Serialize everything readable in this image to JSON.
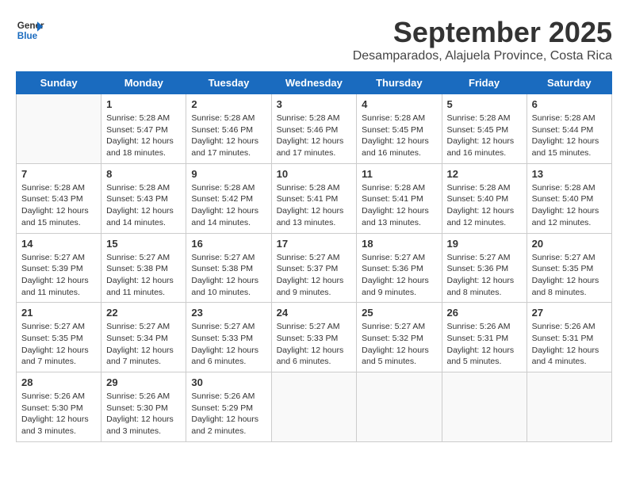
{
  "logo": {
    "line1": "General",
    "line2": "Blue"
  },
  "title": "September 2025",
  "location": "Desamparados, Alajuela Province, Costa Rica",
  "headers": [
    "Sunday",
    "Monday",
    "Tuesday",
    "Wednesday",
    "Thursday",
    "Friday",
    "Saturday"
  ],
  "weeks": [
    [
      {
        "day": "",
        "info": ""
      },
      {
        "day": "1",
        "info": "Sunrise: 5:28 AM\nSunset: 5:47 PM\nDaylight: 12 hours\nand 18 minutes."
      },
      {
        "day": "2",
        "info": "Sunrise: 5:28 AM\nSunset: 5:46 PM\nDaylight: 12 hours\nand 17 minutes."
      },
      {
        "day": "3",
        "info": "Sunrise: 5:28 AM\nSunset: 5:46 PM\nDaylight: 12 hours\nand 17 minutes."
      },
      {
        "day": "4",
        "info": "Sunrise: 5:28 AM\nSunset: 5:45 PM\nDaylight: 12 hours\nand 16 minutes."
      },
      {
        "day": "5",
        "info": "Sunrise: 5:28 AM\nSunset: 5:45 PM\nDaylight: 12 hours\nand 16 minutes."
      },
      {
        "day": "6",
        "info": "Sunrise: 5:28 AM\nSunset: 5:44 PM\nDaylight: 12 hours\nand 15 minutes."
      }
    ],
    [
      {
        "day": "7",
        "info": "Sunrise: 5:28 AM\nSunset: 5:43 PM\nDaylight: 12 hours\nand 15 minutes."
      },
      {
        "day": "8",
        "info": "Sunrise: 5:28 AM\nSunset: 5:43 PM\nDaylight: 12 hours\nand 14 minutes."
      },
      {
        "day": "9",
        "info": "Sunrise: 5:28 AM\nSunset: 5:42 PM\nDaylight: 12 hours\nand 14 minutes."
      },
      {
        "day": "10",
        "info": "Sunrise: 5:28 AM\nSunset: 5:41 PM\nDaylight: 12 hours\nand 13 minutes."
      },
      {
        "day": "11",
        "info": "Sunrise: 5:28 AM\nSunset: 5:41 PM\nDaylight: 12 hours\nand 13 minutes."
      },
      {
        "day": "12",
        "info": "Sunrise: 5:28 AM\nSunset: 5:40 PM\nDaylight: 12 hours\nand 12 minutes."
      },
      {
        "day": "13",
        "info": "Sunrise: 5:28 AM\nSunset: 5:40 PM\nDaylight: 12 hours\nand 12 minutes."
      }
    ],
    [
      {
        "day": "14",
        "info": "Sunrise: 5:27 AM\nSunset: 5:39 PM\nDaylight: 12 hours\nand 11 minutes."
      },
      {
        "day": "15",
        "info": "Sunrise: 5:27 AM\nSunset: 5:38 PM\nDaylight: 12 hours\nand 11 minutes."
      },
      {
        "day": "16",
        "info": "Sunrise: 5:27 AM\nSunset: 5:38 PM\nDaylight: 12 hours\nand 10 minutes."
      },
      {
        "day": "17",
        "info": "Sunrise: 5:27 AM\nSunset: 5:37 PM\nDaylight: 12 hours\nand 9 minutes."
      },
      {
        "day": "18",
        "info": "Sunrise: 5:27 AM\nSunset: 5:36 PM\nDaylight: 12 hours\nand 9 minutes."
      },
      {
        "day": "19",
        "info": "Sunrise: 5:27 AM\nSunset: 5:36 PM\nDaylight: 12 hours\nand 8 minutes."
      },
      {
        "day": "20",
        "info": "Sunrise: 5:27 AM\nSunset: 5:35 PM\nDaylight: 12 hours\nand 8 minutes."
      }
    ],
    [
      {
        "day": "21",
        "info": "Sunrise: 5:27 AM\nSunset: 5:35 PM\nDaylight: 12 hours\nand 7 minutes."
      },
      {
        "day": "22",
        "info": "Sunrise: 5:27 AM\nSunset: 5:34 PM\nDaylight: 12 hours\nand 7 minutes."
      },
      {
        "day": "23",
        "info": "Sunrise: 5:27 AM\nSunset: 5:33 PM\nDaylight: 12 hours\nand 6 minutes."
      },
      {
        "day": "24",
        "info": "Sunrise: 5:27 AM\nSunset: 5:33 PM\nDaylight: 12 hours\nand 6 minutes."
      },
      {
        "day": "25",
        "info": "Sunrise: 5:27 AM\nSunset: 5:32 PM\nDaylight: 12 hours\nand 5 minutes."
      },
      {
        "day": "26",
        "info": "Sunrise: 5:26 AM\nSunset: 5:31 PM\nDaylight: 12 hours\nand 5 minutes."
      },
      {
        "day": "27",
        "info": "Sunrise: 5:26 AM\nSunset: 5:31 PM\nDaylight: 12 hours\nand 4 minutes."
      }
    ],
    [
      {
        "day": "28",
        "info": "Sunrise: 5:26 AM\nSunset: 5:30 PM\nDaylight: 12 hours\nand 3 minutes."
      },
      {
        "day": "29",
        "info": "Sunrise: 5:26 AM\nSunset: 5:30 PM\nDaylight: 12 hours\nand 3 minutes."
      },
      {
        "day": "30",
        "info": "Sunrise: 5:26 AM\nSunset: 5:29 PM\nDaylight: 12 hours\nand 2 minutes."
      },
      {
        "day": "",
        "info": ""
      },
      {
        "day": "",
        "info": ""
      },
      {
        "day": "",
        "info": ""
      },
      {
        "day": "",
        "info": ""
      }
    ]
  ]
}
